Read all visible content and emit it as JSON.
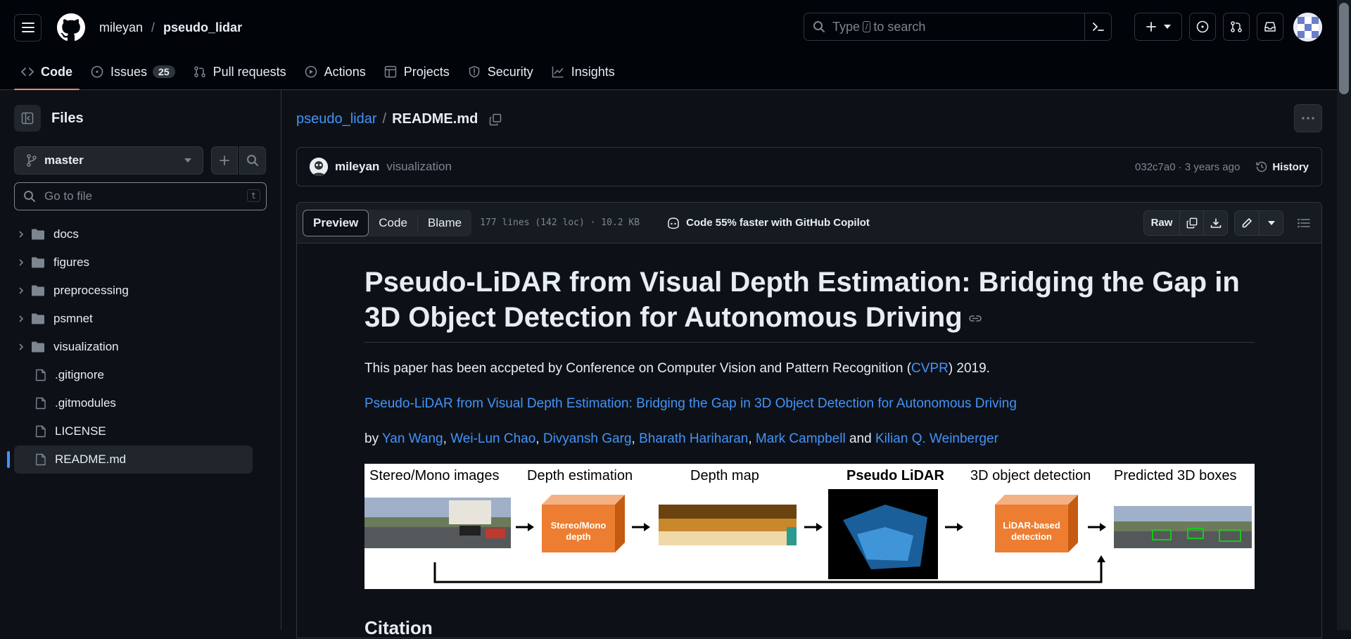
{
  "header": {
    "owner": "mileyan",
    "separator": "/",
    "repo": "pseudo_lidar",
    "search_prefix": "Type",
    "search_key": "/",
    "search_suffix": "to search"
  },
  "repo_nav": [
    {
      "label": "Code",
      "icon": "code-icon",
      "active": true
    },
    {
      "label": "Issues",
      "icon": "issue-icon",
      "count": "25"
    },
    {
      "label": "Pull requests",
      "icon": "pull-request-icon"
    },
    {
      "label": "Actions",
      "icon": "play-icon"
    },
    {
      "label": "Projects",
      "icon": "table-icon"
    },
    {
      "label": "Security",
      "icon": "shield-icon"
    },
    {
      "label": "Insights",
      "icon": "graph-icon"
    }
  ],
  "sidebar": {
    "title": "Files",
    "branch": "master",
    "goto_placeholder": "Go to file",
    "goto_key": "t",
    "tree": [
      {
        "name": "docs",
        "type": "dir"
      },
      {
        "name": "figures",
        "type": "dir"
      },
      {
        "name": "preprocessing",
        "type": "dir"
      },
      {
        "name": "psmnet",
        "type": "dir"
      },
      {
        "name": "visualization",
        "type": "dir"
      },
      {
        "name": ".gitignore",
        "type": "file"
      },
      {
        "name": ".gitmodules",
        "type": "file"
      },
      {
        "name": "LICENSE",
        "type": "file"
      },
      {
        "name": "README.md",
        "type": "file",
        "selected": true
      }
    ]
  },
  "breadcrumb": {
    "repo": "pseudo_lidar",
    "slash": "/",
    "file": "README.md"
  },
  "commit": {
    "author": "mileyan",
    "message": "visualization",
    "meta": "032c7a0 · 3 years ago",
    "history": "History"
  },
  "file_header": {
    "tabs": [
      "Preview",
      "Code",
      "Blame"
    ],
    "active_tab": "Preview",
    "stats": "177 lines (142 loc) · 10.2 KB",
    "copilot": "Code 55% faster with GitHub Copilot",
    "raw": "Raw"
  },
  "readme": {
    "title": "Pseudo-LiDAR from Visual Depth Estimation: Bridging the Gap in 3D Object Detection for Autonomous Driving",
    "p1_before": "This paper has been accpeted by Conference on Computer Vision and Pattern Recognition (",
    "p1_link": "CVPR",
    "p1_after": ") 2019.",
    "paper_link": "Pseudo-LiDAR from Visual Depth Estimation: Bridging the Gap in 3D Object Detection for Autonomous Driving",
    "by": "by",
    "authors": [
      "Yan Wang",
      "Wei-Lun Chao",
      "Divyansh Garg",
      "Bharath Hariharan",
      "Mark Campbell"
    ],
    "and": "and",
    "last_author": "Kilian Q. Weinberger",
    "figure": {
      "labels": [
        "Stereo/Mono images",
        "Depth estimation",
        "Depth map",
        "Pseudo LiDAR",
        "3D object detection",
        "Predicted 3D boxes"
      ],
      "box1": [
        "Stereo/Mono",
        "depth"
      ],
      "box2": [
        "LiDAR-based",
        "detection"
      ]
    },
    "next_heading": "Citation"
  },
  "colors": {
    "accent": "#4493f8",
    "underline": "#f78166",
    "orange": "#ed7d31"
  }
}
